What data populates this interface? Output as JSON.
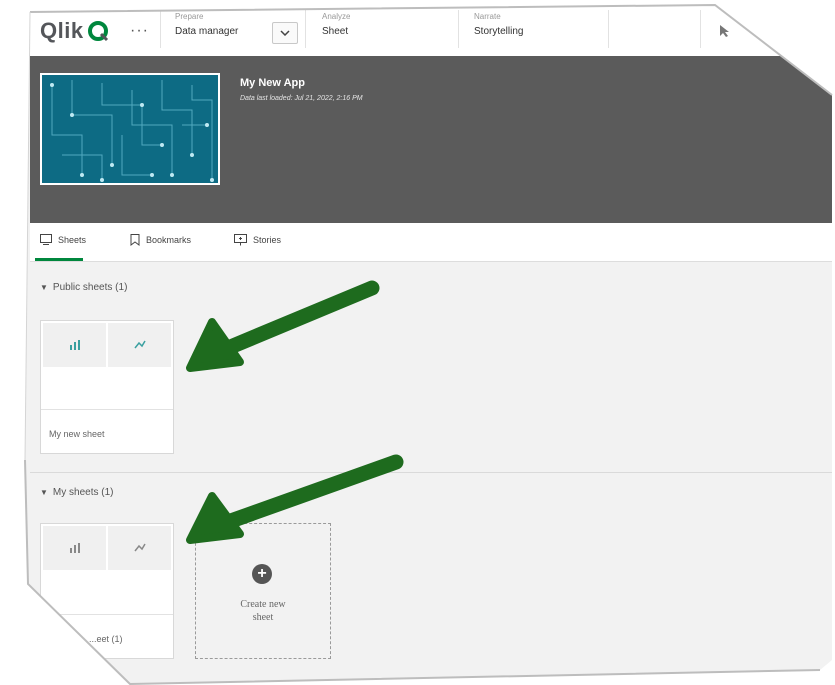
{
  "topbar": {
    "logo": "Qlik",
    "more": "···",
    "prepare_small": "Prepare",
    "prepare_value": "Data manager",
    "analyze_small": "Analyze",
    "analyze_value": "Sheet",
    "narrate_small": "Narrate",
    "narrate_value": "Storytelling"
  },
  "app": {
    "title": "My New App",
    "subtitle": "Data last loaded: Jul 21, 2022, 2:16 PM"
  },
  "tabs": [
    {
      "label": "Sheets",
      "icon": "sheet-icon",
      "active": true
    },
    {
      "label": "Bookmarks",
      "icon": "bookmark-icon",
      "active": false
    },
    {
      "label": "Stories",
      "icon": "story-icon",
      "active": false
    }
  ],
  "public_sheets": {
    "heading": "Public sheets (1)",
    "card_label": "My new sheet"
  },
  "my_sheets": {
    "heading": "My sheets (1)",
    "card_label": "...eet (1)",
    "create_label_1": "Create new",
    "create_label_2": "sheet"
  },
  "colors": {
    "accent": "#00873d",
    "header_bg": "#5b5b5b",
    "thumb_bg": "#0d6b84",
    "arrow": "#1e6b1e"
  }
}
